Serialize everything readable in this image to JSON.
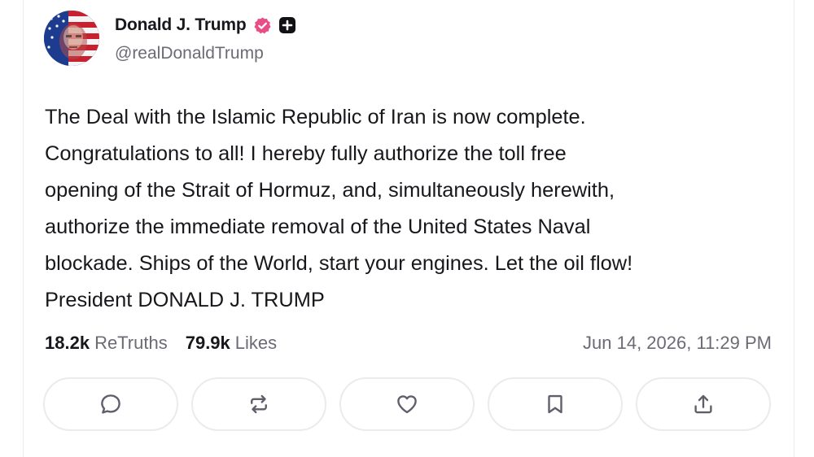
{
  "post": {
    "author": {
      "display_name": "Donald J. Trump",
      "handle": "@realDonaldTrump",
      "verified_icon": "verified-badge-icon",
      "plus_icon": "plus-badge-icon",
      "verified_color": "#e94d86"
    },
    "text": "The Deal with the Islamic Republic of Iran is now complete.\nCongratulations to all! I hereby fully authorize the toll free\nopening of the Strait of Hormuz, and, simultaneously herewith,\nauthorize the immediate removal of the United States Naval\nblockade. Ships of the World, start your engines. Let the oil flow!\nPresident DONALD J. TRUMP",
    "stats": {
      "retruths_count": "18.2k",
      "retruths_label": "ReTruths",
      "likes_count": "79.9k",
      "likes_label": "Likes"
    },
    "timestamp": "Jun 14, 2026, 11:29 PM",
    "actions": [
      {
        "name": "reply",
        "icon": "comment-icon"
      },
      {
        "name": "retruth",
        "icon": "repost-icon"
      },
      {
        "name": "like",
        "icon": "heart-icon"
      },
      {
        "name": "bookmark",
        "icon": "bookmark-icon"
      },
      {
        "name": "share",
        "icon": "share-icon"
      }
    ]
  }
}
